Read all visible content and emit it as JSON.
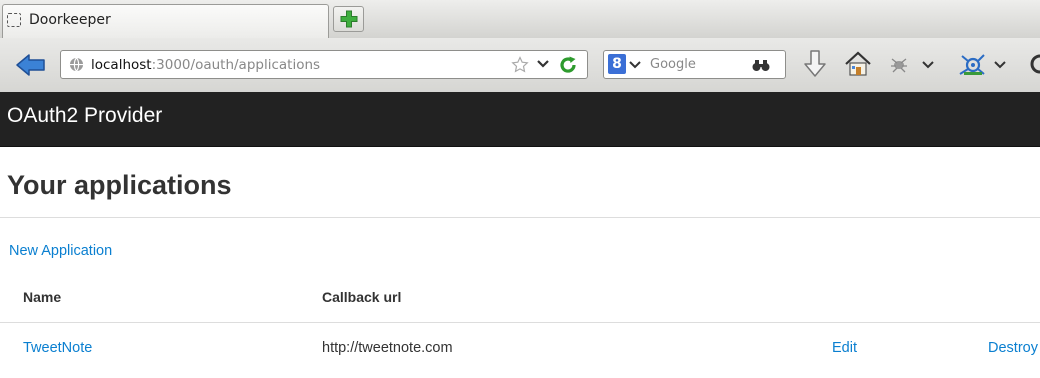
{
  "browser": {
    "tab": {
      "title": "Doorkeeper"
    },
    "address": {
      "host": "localhost",
      "rest": ":3000/oauth/applications"
    },
    "search": {
      "placeholder": "Google",
      "engine_letter": "8"
    }
  },
  "header": {
    "brand": "OAuth2 Provider"
  },
  "main": {
    "title": "Your applications",
    "new_link": "New Application",
    "table": {
      "columns": [
        "Name",
        "Callback url"
      ],
      "rows": [
        {
          "name": "TweetNote",
          "callback": "http://tweetnote.com",
          "edit": "Edit",
          "destroy": "Destroy"
        }
      ]
    }
  },
  "icons": {
    "tab_favicon": "blank-page-icon",
    "new_tab": "plus-icon",
    "back": "back-arrow-icon",
    "site": "globe-icon",
    "bookmark": "star-icon",
    "reload": "reload-icon",
    "search_go": "binoculars-icon",
    "downloads": "download-arrow-icon",
    "home": "home-icon",
    "addon": "bug-icon",
    "network": "network-icon"
  },
  "colors": {
    "link": "#0a7fd0",
    "navbar_bg": "#222222",
    "reload_green": "#2e9b2e",
    "new_tab_green": "#3fae3f"
  }
}
